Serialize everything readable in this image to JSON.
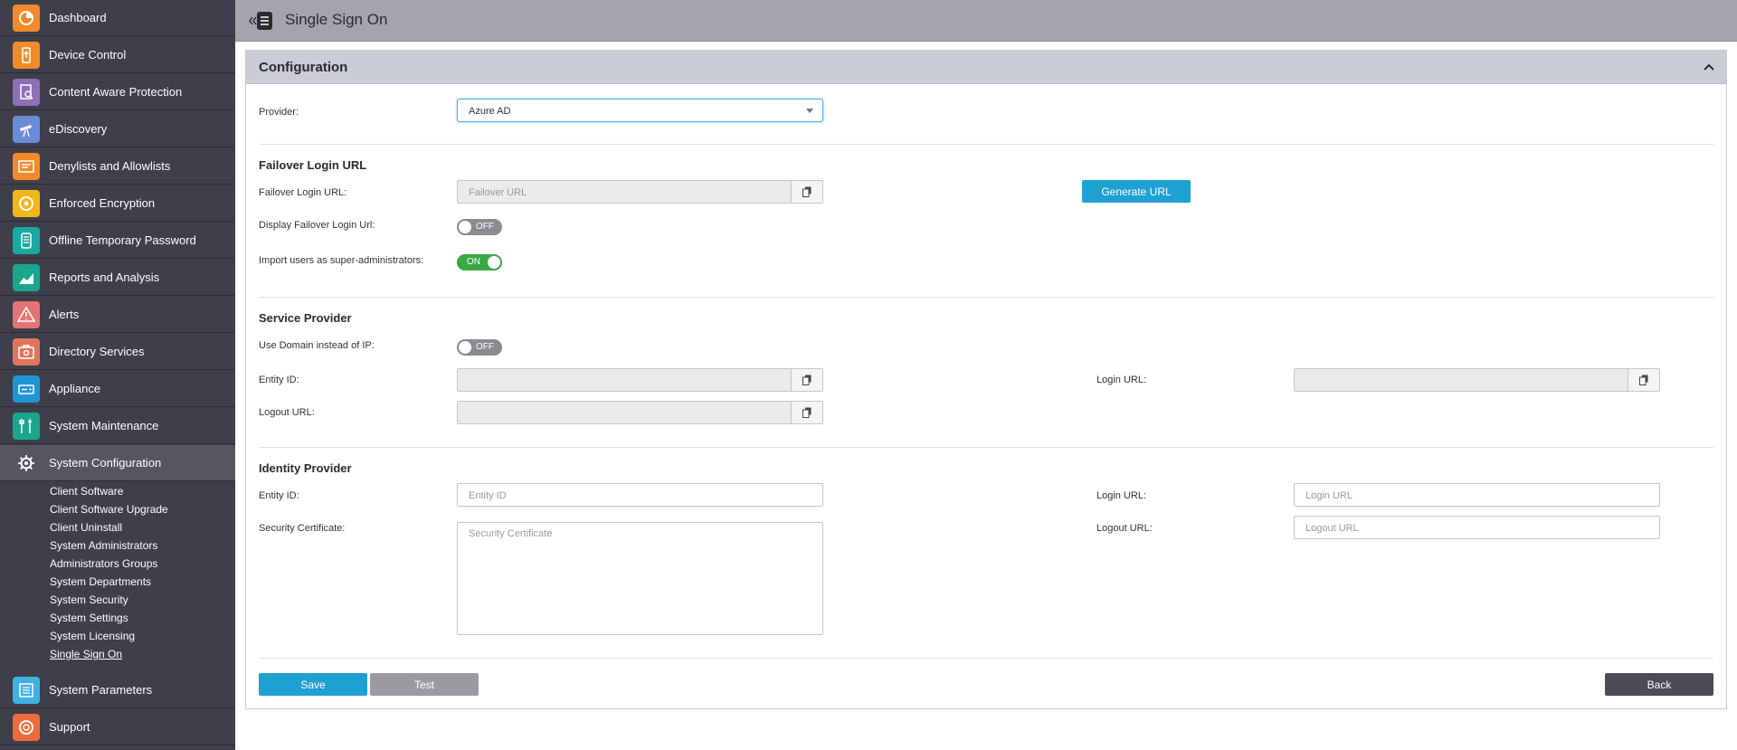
{
  "sidebar": {
    "items": [
      {
        "label": "Dashboard",
        "icon": "dashboard-icon",
        "color": "#f08a2b"
      },
      {
        "label": "Device Control",
        "icon": "usb-icon",
        "color": "#f08a2b"
      },
      {
        "label": "Content Aware Protection",
        "icon": "content-scan-icon",
        "color": "#8c70b8"
      },
      {
        "label": "eDiscovery",
        "icon": "telescope-icon",
        "color": "#6a8cd6"
      },
      {
        "label": "Denylists and Allowlists",
        "icon": "list-window-icon",
        "color": "#f08a2b"
      },
      {
        "label": "Enforced Encryption",
        "icon": "lock-disc-icon",
        "color": "#f2b51a"
      },
      {
        "label": "Offline Temporary Password",
        "icon": "password-device-icon",
        "color": "#1aa9a0"
      },
      {
        "label": "Reports and Analysis",
        "icon": "chart-icon",
        "color": "#19a68c"
      },
      {
        "label": "Alerts",
        "icon": "warning-icon",
        "color": "#e57373"
      },
      {
        "label": "Directory Services",
        "icon": "directory-icon",
        "color": "#e0755c"
      },
      {
        "label": "Appliance",
        "icon": "appliance-icon",
        "color": "#1f95d6"
      },
      {
        "label": "System Maintenance",
        "icon": "wrench-icon",
        "color": "#19a68c"
      },
      {
        "label": "System Configuration",
        "icon": "gear-icon",
        "color": "#55565f"
      },
      {
        "label": "System Parameters",
        "icon": "list-icon",
        "color": "#3fb0e3"
      },
      {
        "label": "Support",
        "icon": "lifebuoy-icon",
        "color": "#f06b3a"
      }
    ],
    "sub_items": [
      "Client Software",
      "Client Software Upgrade",
      "Client Uninstall",
      "System Administrators",
      "Administrators Groups",
      "System Departments",
      "System Security",
      "System Settings",
      "System Licensing",
      "Single Sign On"
    ]
  },
  "header": {
    "title": "Single Sign On"
  },
  "panel": {
    "title": "Configuration",
    "provider_label": "Provider:",
    "provider_value": "Azure AD",
    "failover": {
      "section_title": "Failover Login URL",
      "url_label": "Failover Login URL:",
      "url_placeholder": "Failover URL",
      "generate_button": "Generate URL",
      "display_label": "Display Failover Login Url:",
      "display_toggle": "OFF",
      "import_label": "Import users as super-administrators:",
      "import_toggle": "ON"
    },
    "service_provider": {
      "section_title": "Service Provider",
      "use_domain_label": "Use Domain instead of IP:",
      "use_domain_toggle": "OFF",
      "entity_label": "Entity ID:",
      "login_label": "Login URL:",
      "logout_label": "Logout URL:"
    },
    "identity_provider": {
      "section_title": "Identity Provider",
      "entity_label": "Entity ID:",
      "entity_placeholder": "Entity ID",
      "cert_label": "Security Certificate:",
      "cert_placeholder": "Security Certificate",
      "login_label": "Login URL:",
      "login_placeholder": "Login URL",
      "logout_label": "Logout URL:",
      "logout_placeholder": "Logout URL"
    },
    "actions": {
      "save": "Save",
      "test": "Test",
      "back": "Back"
    }
  }
}
